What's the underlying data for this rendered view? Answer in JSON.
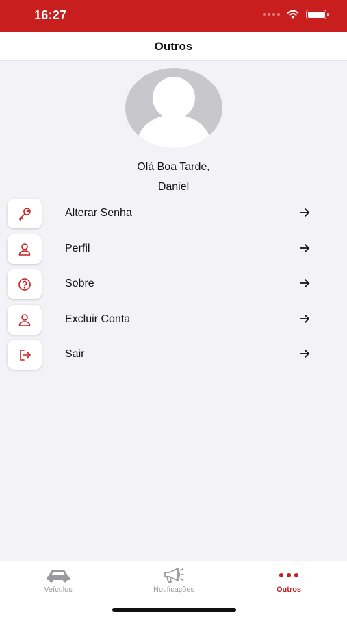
{
  "status_bar": {
    "time": "16:27",
    "battery_level": 1.0
  },
  "header": {
    "title": "Outros"
  },
  "profile": {
    "greeting": "Olá Boa Tarde,",
    "name": "Daniel"
  },
  "menu": {
    "items": [
      {
        "label": "Alterar Senha",
        "icon": "key-icon"
      },
      {
        "label": "Perfil",
        "icon": "user-icon"
      },
      {
        "label": "Sobre",
        "icon": "help-circle-icon"
      },
      {
        "label": "Excluir Conta",
        "icon": "user-icon"
      },
      {
        "label": "Sair",
        "icon": "logout-icon"
      }
    ]
  },
  "tabbar": {
    "tabs": [
      {
        "label": "Veículos",
        "icon": "car-icon",
        "active": false
      },
      {
        "label": "Notificações",
        "icon": "megaphone-icon",
        "active": false
      },
      {
        "label": "Outros",
        "icon": "more-dots-icon",
        "active": true
      }
    ]
  },
  "colors": {
    "accent": "#c81e1e",
    "background": "#f2f2f7",
    "inactive": "#9a9a9e"
  }
}
